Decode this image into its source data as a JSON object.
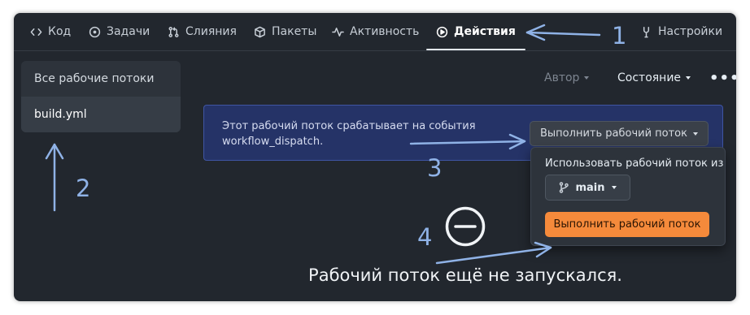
{
  "nav": {
    "tabs": [
      {
        "label": "Код",
        "icon": "code-icon"
      },
      {
        "label": "Задачи",
        "icon": "issue-icon"
      },
      {
        "label": "Слияния",
        "icon": "pull-request-icon"
      },
      {
        "label": "Пакеты",
        "icon": "package-icon"
      },
      {
        "label": "Активность",
        "icon": "activity-icon"
      },
      {
        "label": "Действия",
        "icon": "play-icon",
        "active": true
      },
      {
        "label": "Настройки",
        "icon": "wrench-icon"
      }
    ]
  },
  "sidebar": {
    "items": [
      {
        "label": "Все рабочие потоки"
      },
      {
        "label": "build.yml",
        "selected": true
      }
    ]
  },
  "filters": {
    "author": "Автор",
    "state": "Состояние",
    "more": "•••"
  },
  "banner": {
    "text": "Этот рабочий поток срабатывает на события workflow_dispatch.",
    "run_button": "Выполнить рабочий поток"
  },
  "dropdown": {
    "title": "Использовать рабочий поток из",
    "branch": "main",
    "run_button": "Выполнить рабочий поток"
  },
  "empty_state": {
    "text": "Рабочий поток ещё не запускался."
  },
  "annotations": {
    "n1": "1",
    "n2": "2",
    "n3": "3",
    "n4": "4"
  },
  "colors": {
    "background": "#22272e",
    "banner": "#253367",
    "primary_button": "#f58a3b",
    "annotation": "#8fb2e6"
  }
}
